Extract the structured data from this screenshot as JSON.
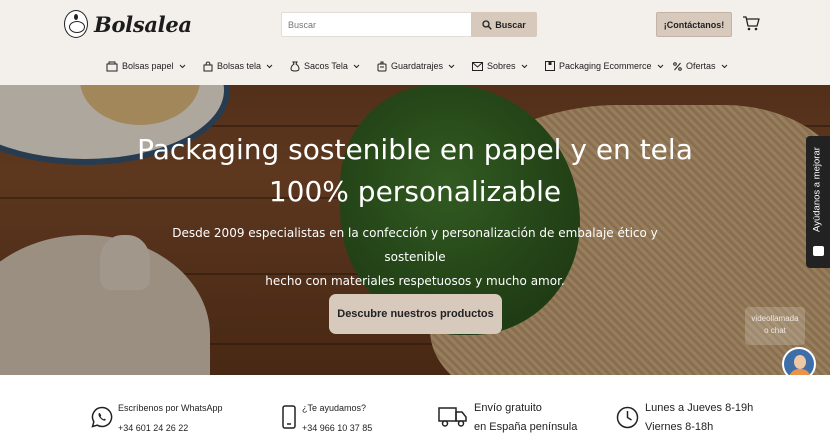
{
  "header": {
    "logo_text": "Bolsalea",
    "search": {
      "placeholder": "Buscar",
      "button_label": "Buscar"
    },
    "contact_label": "¡Contáctanos!",
    "cart_icon": "cart-icon"
  },
  "nav": {
    "items": [
      {
        "label": "Bolsas papel",
        "icon": "bag-icon"
      },
      {
        "label": "Bolsas tela",
        "icon": "tote-icon"
      },
      {
        "label": "Sacos Tela",
        "icon": "sack-icon"
      },
      {
        "label": "Guardatrajes",
        "icon": "garment-icon"
      },
      {
        "label": "Sobres",
        "icon": "envelope-icon"
      },
      {
        "label": "Packaging Ecommerce",
        "icon": "box-icon"
      },
      {
        "label": "Ofertas",
        "icon": "percent-icon"
      }
    ]
  },
  "hero": {
    "title_line1": "Packaging sostenible en papel y en tela",
    "title_line2": "100% personalizable",
    "subtitle_line1": "Desde 2009 especialistas en la confección y personalización de embalaje ético y sostenible",
    "subtitle_line2": "hecho con materiales respetuosos y mucho amor.",
    "cta_label": "Descubre nuestros productos"
  },
  "widgets": {
    "feedback_label": "Ayúdanos a mejorar",
    "video_chat_line1": "videollamada",
    "video_chat_line2": "o chat"
  },
  "features": [
    {
      "icon": "whatsapp-icon",
      "line1": "Escríbenos por WhatsApp",
      "line2": "+34 601 24 26 22"
    },
    {
      "icon": "phone-icon",
      "line1": "¿Te ayudamos?",
      "line2": "+34 966 10 37 85"
    },
    {
      "icon": "truck-icon",
      "line1": "Envío gratuito",
      "line2": "en España península"
    },
    {
      "icon": "clock-icon",
      "line1": "Lunes a Jueves 8-19h",
      "line2": "Viernes 8-18h"
    }
  ],
  "colors": {
    "header_bg": "#f3efea",
    "accent": "#d8c9bd",
    "whatsapp": "#25d366"
  }
}
